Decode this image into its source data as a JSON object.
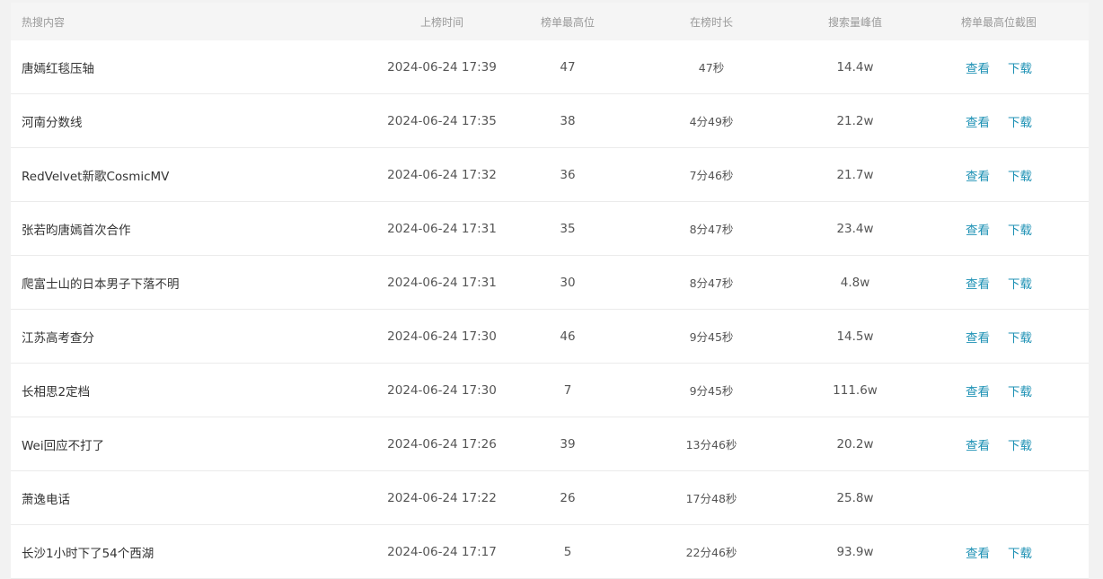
{
  "header": {
    "title": "热搜内容",
    "time": "上榜时间",
    "rank": "榜单最高位",
    "duration": "在榜时长",
    "peak": "搜索量峰值",
    "screenshot": "榜单最高位截图"
  },
  "link_labels": {
    "view": "查看",
    "download": "下载"
  },
  "colors": {
    "link": "#1f92b5",
    "header_bg": "#f5f5f5",
    "row_bg": "#ffffff"
  },
  "rows": [
    {
      "title": "唐嫣红毯压轴",
      "time": "2024-06-24 17:39",
      "rank": "47",
      "duration": "47秒",
      "peak": "14.4w",
      "view": "查看",
      "download": "下载"
    },
    {
      "title": "河南分数线",
      "time": "2024-06-24 17:35",
      "rank": "38",
      "duration": "4分49秒",
      "peak": "21.2w",
      "view": "查看",
      "download": "下载"
    },
    {
      "title": "RedVelvet新歌CosmicMV",
      "time": "2024-06-24 17:32",
      "rank": "36",
      "duration": "7分46秒",
      "peak": "21.7w",
      "view": "查看",
      "download": "下载"
    },
    {
      "title": "张若昀唐嫣首次合作",
      "time": "2024-06-24 17:31",
      "rank": "35",
      "duration": "8分47秒",
      "peak": "23.4w",
      "view": "查看",
      "download": "下载"
    },
    {
      "title": "爬富士山的日本男子下落不明",
      "time": "2024-06-24 17:31",
      "rank": "30",
      "duration": "8分47秒",
      "peak": "4.8w",
      "view": "查看",
      "download": "下载"
    },
    {
      "title": "江苏高考查分",
      "time": "2024-06-24 17:30",
      "rank": "46",
      "duration": "9分45秒",
      "peak": "14.5w",
      "view": "查看",
      "download": "下载"
    },
    {
      "title": "长相思2定档",
      "time": "2024-06-24 17:30",
      "rank": "7",
      "duration": "9分45秒",
      "peak": "111.6w",
      "view": "查看",
      "download": "下载"
    },
    {
      "title": "Wei回应不打了",
      "time": "2024-06-24 17:26",
      "rank": "39",
      "duration": "13分46秒",
      "peak": "20.2w",
      "view": "查看",
      "download": "下载"
    },
    {
      "title": "萧逸电话",
      "time": "2024-06-24 17:22",
      "rank": "26",
      "duration": "17分48秒",
      "peak": "25.8w",
      "view": "",
      "download": ""
    },
    {
      "title": "长沙1小时下了54个西湖",
      "time": "2024-06-24 17:17",
      "rank": "5",
      "duration": "22分46秒",
      "peak": "93.9w",
      "view": "查看",
      "download": "下载"
    }
  ]
}
